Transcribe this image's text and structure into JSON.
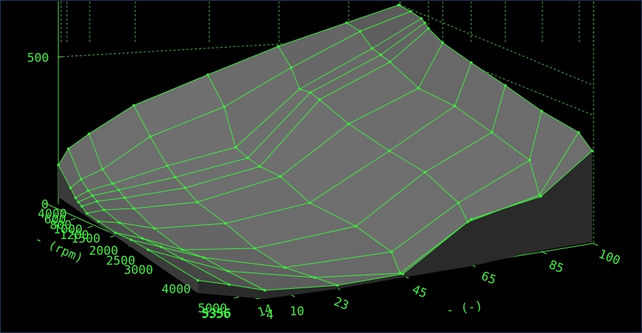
{
  "chart_data": {
    "type": "surface3d",
    "title": "",
    "x_axis": {
      "label": "- (rpm)",
      "ticks": [
        0,
        400,
        600,
        800,
        1000,
        1200,
        1500,
        2000,
        2500,
        3000,
        4000,
        5000,
        5356
      ],
      "tick_labels": [
        "0",
        "4000",
        "600",
        "800",
        "1000",
        "1200",
        "1500",
        "2000",
        "2500",
        "3000",
        "4000",
        "5000",
        "5356"
      ]
    },
    "y_axis": {
      "label": "- (-)",
      "ticks": [
        4,
        10,
        23,
        45,
        65,
        85,
        100
      ],
      "tick_labels": [
        "4",
        "10",
        "23",
        "45",
        "65",
        "85",
        "100"
      ]
    },
    "extra_tick_labels": [
      "5356",
      "14"
    ],
    "z_axis": {
      "ticks": [
        500
      ],
      "tick_labels": [
        "500"
      ]
    },
    "colors": {
      "background": "#000000",
      "mesh": "#3df23d",
      "surface_light": "#6f6f6f",
      "surface_dark": "#333333",
      "frame_border": "#1b3a66"
    }
  }
}
